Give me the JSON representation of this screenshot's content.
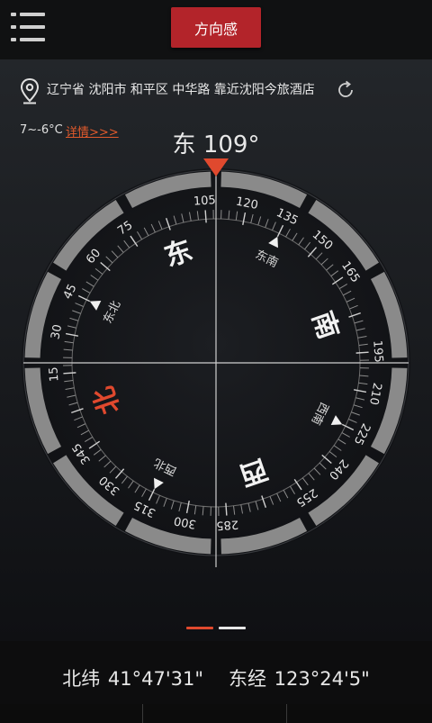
{
  "header": {
    "title_button": "方向感",
    "menu_icon": "hamburger-menu-icon"
  },
  "location": {
    "icon": "map-pin-icon",
    "address": "辽宁省 沈阳市 和平区 中华路 靠近沈阳今旅酒店",
    "refresh_icon": "refresh-icon"
  },
  "weather": {
    "temperature": "7~-6°C",
    "detail_link": "详情>>>"
  },
  "compass": {
    "heading_direction": "东",
    "heading_degrees": "109°",
    "heading_value": 109,
    "cardinals": [
      {
        "label": "北",
        "bearing": 0,
        "highlight": true
      },
      {
        "label": "东",
        "bearing": 90,
        "highlight": false
      },
      {
        "label": "南",
        "bearing": 180,
        "highlight": false
      },
      {
        "label": "西",
        "bearing": 270,
        "highlight": false
      }
    ],
    "intercardinals": [
      {
        "label": "东北",
        "bearing": 45
      },
      {
        "label": "东南",
        "bearing": 135
      },
      {
        "label": "西南",
        "bearing": 225
      },
      {
        "label": "西北",
        "bearing": 315
      }
    ],
    "degree_labels": [
      "15",
      "30",
      "45",
      "60",
      "75",
      "105",
      "120",
      "135",
      "150",
      "165",
      "195",
      "210",
      "225",
      "240",
      "255",
      "285",
      "300",
      "315",
      "330",
      "345"
    ],
    "colors": {
      "accent": "#e0492e",
      "ring": "#8a8a8a",
      "north": "#e0492e"
    }
  },
  "pager": {
    "pages": 2,
    "active": 0,
    "active_color": "#e0492e",
    "inactive_color": "#e6e6e6"
  },
  "coordinates": {
    "latitude": "北纬 41°47'31\"",
    "longitude": "东经 123°24'5\""
  },
  "tabs": [
    {
      "name": "tab-1"
    },
    {
      "name": "tab-2"
    },
    {
      "name": "tab-3"
    }
  ]
}
